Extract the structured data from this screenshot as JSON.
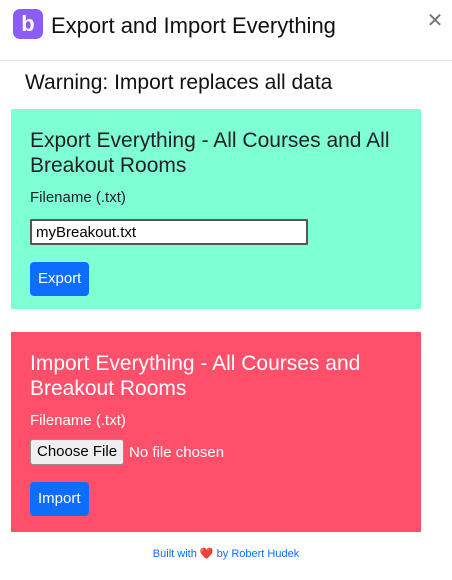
{
  "header": {
    "logo_letter": "b",
    "title": "Export and Import Everything",
    "close_glyph": "✕"
  },
  "warning": "Warning: Import replaces all data",
  "export": {
    "heading": "Export Everything - All Courses and All Breakout Rooms",
    "filename_label": "Filename (.txt)",
    "filename_value": "myBreakout.txt",
    "button_label": "Export",
    "bg_color": "#7fffd4"
  },
  "import": {
    "heading": "Import Everything - All Courses and Breakout Rooms",
    "filename_label": "Filename (.txt)",
    "choose_file_label": "Choose File",
    "file_status": "No file chosen",
    "button_label": "Import",
    "bg_color": "#ff4f6a"
  },
  "footer": {
    "prefix": "Built with",
    "heart": "❤️",
    "suffix": "by Robert Hudek"
  },
  "colors": {
    "accent": "#0d6efd",
    "logo": "#8b5cf6"
  },
  "icons": {
    "logo": "b-logo-icon",
    "close": "close-icon",
    "heart": "heart-icon"
  }
}
